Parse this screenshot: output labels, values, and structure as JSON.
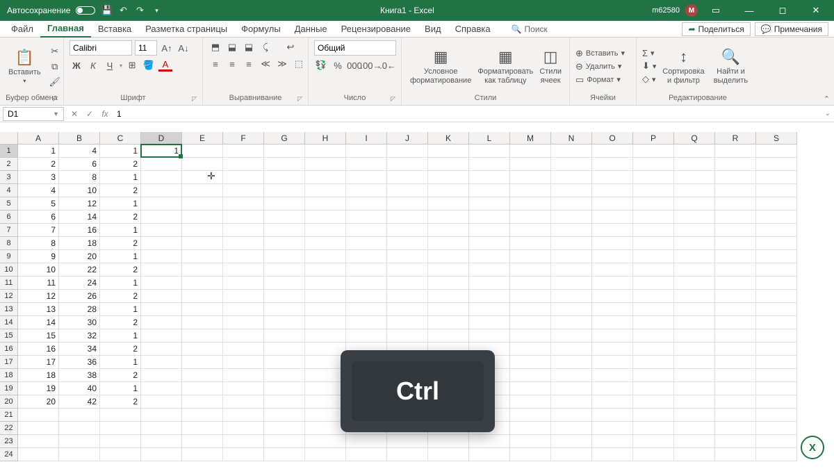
{
  "titlebar": {
    "autosave_label": "Автосохранение",
    "doc_title": "Книга1 - Excel",
    "username": "m62580",
    "user_initial": "M"
  },
  "tabs": {
    "items": [
      "Файл",
      "Главная",
      "Вставка",
      "Разметка страницы",
      "Формулы",
      "Данные",
      "Рецензирование",
      "Вид",
      "Справка"
    ],
    "active_index": 1,
    "search_label": "Поиск",
    "share_label": "Поделиться",
    "comments_label": "Примечания"
  },
  "ribbon": {
    "clipboard": {
      "paste": "Вставить",
      "label": "Буфер обмена"
    },
    "font": {
      "name": "Calibri",
      "size": "11",
      "bold": "Ж",
      "italic": "К",
      "underline": "Ч",
      "label": "Шрифт"
    },
    "alignment": {
      "label": "Выравнивание"
    },
    "number": {
      "format": "Общий",
      "label": "Число"
    },
    "styles": {
      "cond": "Условное форматирование",
      "astable": "Форматировать как таблицу",
      "cellstyles": "Стили ячеек",
      "label": "Стили"
    },
    "cells": {
      "insert": "Вставить",
      "delete": "Удалить",
      "format": "Формат",
      "label": "Ячейки"
    },
    "editing": {
      "sort": "Сортировка и фильтр",
      "find": "Найти и выделить",
      "label": "Редактирование"
    }
  },
  "formula_bar": {
    "namebox": "D1",
    "value": "1"
  },
  "grid": {
    "columns": [
      "A",
      "B",
      "C",
      "D",
      "E",
      "F",
      "G",
      "H",
      "I",
      "J",
      "K",
      "L",
      "M",
      "N",
      "O",
      "P",
      "Q",
      "R",
      "S"
    ],
    "visible_rows": 24,
    "selected_cell": {
      "col": "D",
      "row": 1
    },
    "data": {
      "A": [
        1,
        2,
        3,
        4,
        5,
        6,
        7,
        8,
        9,
        10,
        11,
        12,
        13,
        14,
        15,
        16,
        17,
        18,
        19,
        20
      ],
      "B": [
        4,
        6,
        8,
        10,
        12,
        14,
        16,
        18,
        20,
        22,
        24,
        26,
        28,
        30,
        32,
        34,
        36,
        38,
        40,
        42
      ],
      "C": [
        1,
        2,
        1,
        2,
        1,
        2,
        1,
        2,
        1,
        2,
        1,
        2,
        1,
        2,
        1,
        2,
        1,
        2,
        1,
        2
      ],
      "D": [
        1
      ]
    }
  },
  "key_overlay": "Ctrl"
}
